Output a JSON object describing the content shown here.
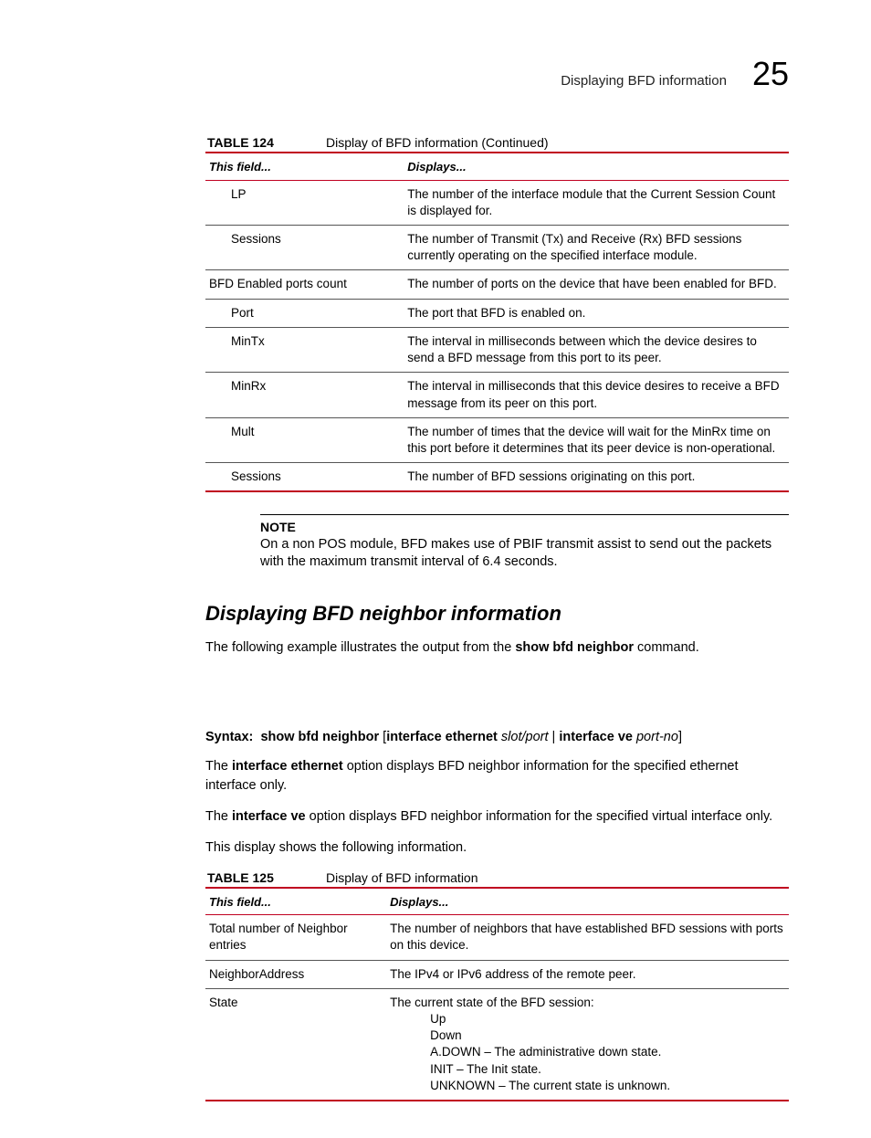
{
  "header": {
    "running_title": "Displaying BFD information",
    "chapter_number": "25"
  },
  "table124": {
    "label": "TABLE 124",
    "title": "Display of BFD information  (Continued)",
    "col1": "This field...",
    "col2": "Displays...",
    "rows": [
      {
        "f": "LP",
        "d": "The number of the interface module that the Current Session Count is displayed for."
      },
      {
        "f": "Sessions",
        "d": "The number of Transmit (Tx) and Receive (Rx) BFD sessions currently operating on the specified interface module."
      }
    ],
    "bfd_row": {
      "f": "BFD Enabled ports count",
      "d": "The number of ports on the device that have been enabled for BFD."
    },
    "rows2": [
      {
        "f": "Port",
        "d": "The port that BFD is enabled on."
      },
      {
        "f": "MinTx",
        "d": "The interval in milliseconds between which the device desires to send a BFD message from this port to its peer."
      },
      {
        "f": "MinRx",
        "d": "The interval in milliseconds that this device desires to receive a BFD message from its peer on this port."
      },
      {
        "f": "Mult",
        "d": "The number of times that the device will wait for the MinRx time on this port before it determines that its peer device is non-operational."
      },
      {
        "f": "Sessions",
        "d": "The number of BFD sessions originating on this port."
      }
    ]
  },
  "note": {
    "label": "NOTE",
    "body": "On a non POS module, BFD makes use of PBIF transmit assist to send out the packets with the maximum transmit interval of 6.4 seconds."
  },
  "section_title": "Displaying BFD neighbor information",
  "intro": {
    "pre": "The following example illustrates the output from the ",
    "cmd": "show bfd neighbor",
    "post": " command."
  },
  "syntax": {
    "label": "Syntax:",
    "c1": "show bfd neighbor",
    "c2": "[",
    "c3": "interface ethernet",
    "v1": "slot/port",
    "sep": " | ",
    "c4": "interface ve",
    "v2": "port-no",
    "c5": "]"
  },
  "para_ethernet": {
    "pre": "The ",
    "b": "interface ethernet",
    "post": " option displays BFD neighbor information for the specified ethernet interface only."
  },
  "para_ve": {
    "pre": "The ",
    "b": "interface ve",
    "post": " option displays BFD neighbor information for the specified virtual interface only."
  },
  "para_display": "This display shows the following information.",
  "table125": {
    "label": "TABLE 125",
    "title": "Display of BFD information",
    "col1": "This field...",
    "col2": "Displays...",
    "rows": [
      {
        "f": "Total number of Neighbor entries",
        "d": "The number of neighbors that have established BFD sessions with ports on this device."
      },
      {
        "f": "NeighborAddress",
        "d": "The IPv4 or IPv6 address of the remote peer."
      }
    ],
    "state_field": "State",
    "state_intro": "The current state of the BFD session:",
    "state_list": [
      "Up",
      "Down",
      "A.DOWN – The administrative down state.",
      "INIT – The Init state.",
      "UNKNOWN – The current state is unknown."
    ]
  }
}
